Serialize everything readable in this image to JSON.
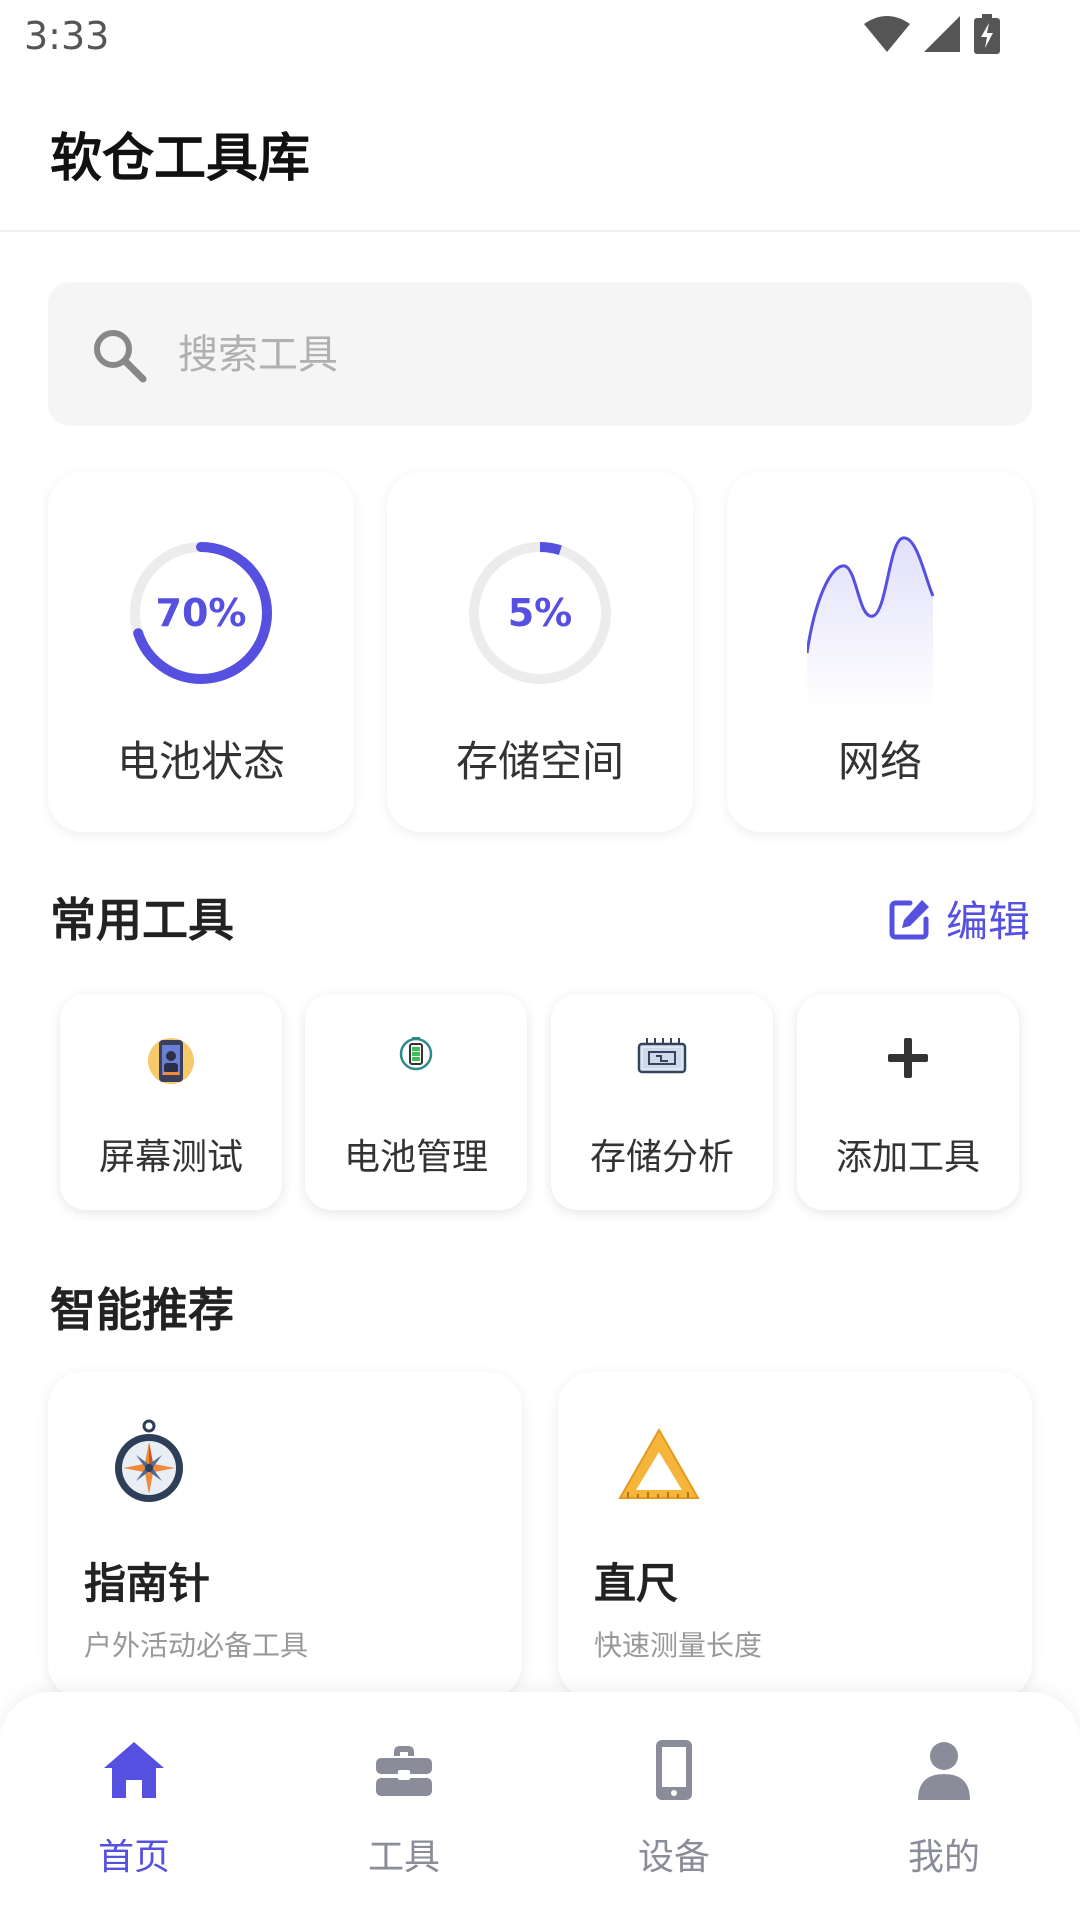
{
  "status_bar": {
    "time": "3:33"
  },
  "header": {
    "title": "软仓工具库"
  },
  "search": {
    "placeholder": "搜索工具",
    "value": ""
  },
  "stats": [
    {
      "label": "电池状态",
      "value_text": "70%",
      "percent": 70
    },
    {
      "label": "存储空间",
      "value_text": "5%",
      "percent": 5
    },
    {
      "label": "网络"
    }
  ],
  "common_tools": {
    "title": "常用工具",
    "edit_label": "编辑",
    "items": [
      {
        "label": "屏幕测试",
        "icon": "phone-screen-icon"
      },
      {
        "label": "电池管理",
        "icon": "battery-icon"
      },
      {
        "label": "存储分析",
        "icon": "storage-chip-icon"
      },
      {
        "label": "添加工具",
        "icon": "plus-icon"
      }
    ]
  },
  "recommend": {
    "title": "智能推荐",
    "items": [
      {
        "title": "指南针",
        "desc": "户外活动必备工具",
        "icon": "compass-icon"
      },
      {
        "title": "直尺",
        "desc": "快速测量长度",
        "icon": "ruler-triangle-icon"
      }
    ]
  },
  "nav": {
    "items": [
      {
        "label": "首页",
        "icon": "home-icon",
        "active": true
      },
      {
        "label": "工具",
        "icon": "toolbox-icon",
        "active": false
      },
      {
        "label": "设备",
        "icon": "phone-icon",
        "active": false
      },
      {
        "label": "我的",
        "icon": "person-icon",
        "active": false
      }
    ]
  },
  "colors": {
    "accent": "#5550e0",
    "inactive": "#8a8d99",
    "card_text": "#333333",
    "muted": "#999999"
  }
}
